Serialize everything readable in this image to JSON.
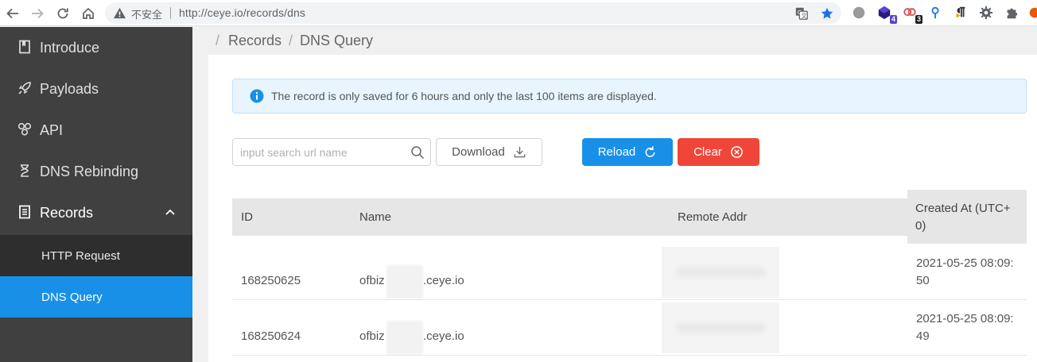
{
  "browser": {
    "insecure_label": "不安全",
    "url": "http://ceye.io/records/dns",
    "extensions": [
      {
        "name": "gray-circle",
        "badge": ""
      },
      {
        "name": "cube",
        "badge": "4",
        "badge_color": "#5b3fd6"
      },
      {
        "name": "link",
        "badge": "3",
        "badge_color": "#202124"
      },
      {
        "name": "pin",
        "badge": ""
      },
      {
        "name": "pilcrow",
        "badge": ""
      },
      {
        "name": "gear",
        "badge": ""
      },
      {
        "name": "puzzle",
        "badge": ""
      }
    ]
  },
  "sidebar": {
    "items": [
      {
        "label": "Introduce",
        "icon": "book-icon"
      },
      {
        "label": "Payloads",
        "icon": "rocket-icon"
      },
      {
        "label": "API",
        "icon": "api-icon"
      },
      {
        "label": "DNS Rebinding",
        "icon": "hourglass-icon"
      },
      {
        "label": "Records",
        "icon": "list-icon",
        "expanded": true
      }
    ],
    "subitems": [
      {
        "label": "HTTP Request",
        "active": false
      },
      {
        "label": "DNS Query",
        "active": true
      }
    ]
  },
  "breadcrumb": {
    "sep": "/",
    "items": [
      "Records",
      "DNS Query"
    ]
  },
  "alert": {
    "text": "The record is only saved for 6 hours and only the last 100 items are displayed."
  },
  "search": {
    "placeholder": "input search url name",
    "value": ""
  },
  "buttons": {
    "download": "Download",
    "reload": "Reload",
    "clear": "Clear"
  },
  "table": {
    "columns": [
      "ID",
      "Name",
      "Remote Addr",
      "Created At (UTC+0)"
    ],
    "created_col_line1": "Created At (UTC+",
    "created_col_line2": "0)",
    "rows": [
      {
        "id": "168250625",
        "name_prefix": "ofbiz",
        "name_suffix": ".ceye.io",
        "created_line1": "2021-05-25 08:09:",
        "created_line2": "50"
      },
      {
        "id": "168250624",
        "name_prefix": "ofbiz",
        "name_suffix": ".ceye.io",
        "created_line1": "2021-05-25 08:09:",
        "created_line2": "49"
      }
    ]
  },
  "colors": {
    "accent": "#1890e8",
    "danger": "#f0463a",
    "sidebar_bg": "#404040"
  }
}
